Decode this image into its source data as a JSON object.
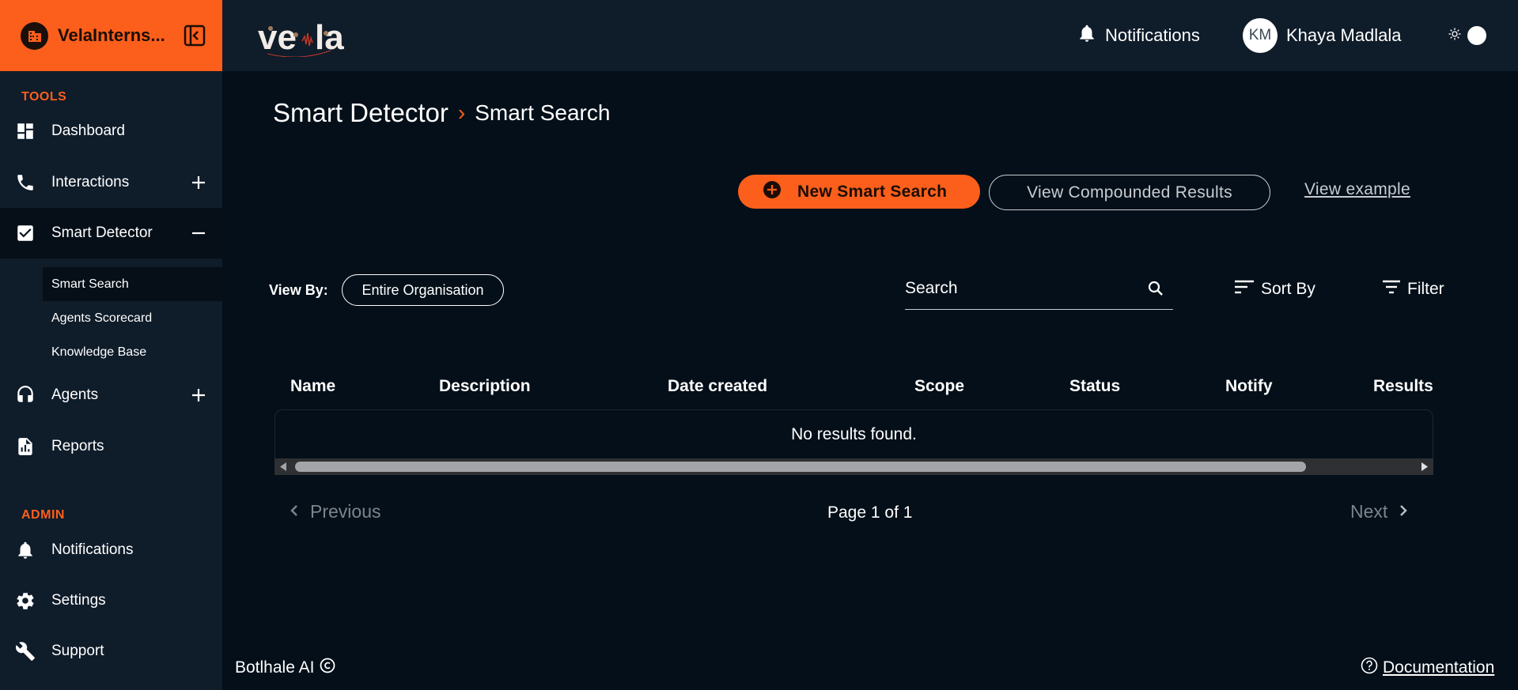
{
  "sidebar": {
    "org_name": "VelaInterns...",
    "sections": {
      "tools": "TOOLS",
      "admin": "ADMIN"
    },
    "items": {
      "dashboard": "Dashboard",
      "interactions": "Interactions",
      "smart_detector": "Smart Detector",
      "agents": "Agents",
      "reports": "Reports",
      "notifications": "Notifications",
      "settings": "Settings",
      "support": "Support"
    },
    "sub_items": {
      "smart_search": "Smart Search",
      "agents_scorecard": "Agents Scorecard",
      "knowledge_base": "Knowledge Base"
    }
  },
  "header": {
    "logo_text": "ve la",
    "notifications_label": "Notifications",
    "user_initials": "KM",
    "user_name": "Khaya Madlala"
  },
  "breadcrumb": {
    "root": "Smart Detector",
    "separator": "›",
    "current": "Smart Search"
  },
  "actions": {
    "new_search": "New Smart Search",
    "view_compounded": "View Compounded Results",
    "view_example": "View example"
  },
  "filters": {
    "view_by_label": "View By:",
    "view_by_value": "Entire Organisation",
    "search_placeholder": "Search",
    "sort_by": "Sort By",
    "filter": "Filter"
  },
  "table": {
    "columns": [
      "Name",
      "Description",
      "Date created",
      "Scope",
      "Status",
      "Notify",
      "Results"
    ],
    "empty_message": "No results found."
  },
  "pagination": {
    "previous": "Previous",
    "info": "Page 1 of 1",
    "next": "Next"
  },
  "footer": {
    "brand": "Botlhale AI",
    "documentation": "Documentation"
  },
  "colors": {
    "accent": "#fc5f1c",
    "sidebar_bg": "#0f1c2a",
    "main_bg": "#040f19"
  }
}
